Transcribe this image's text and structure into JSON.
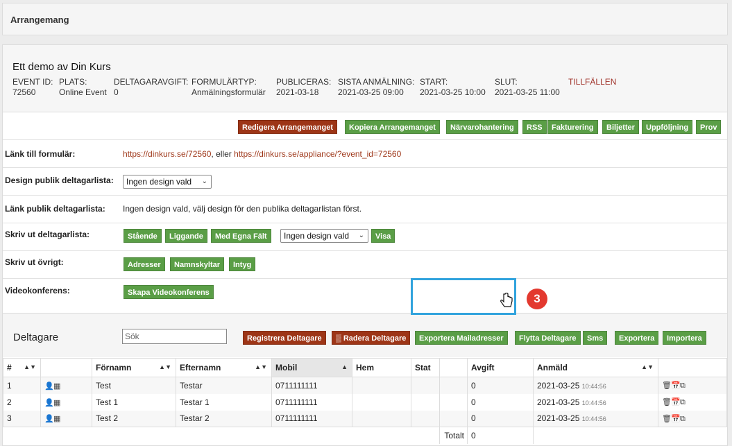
{
  "header": {
    "title": "Arrangemang"
  },
  "event": {
    "title": "Ett demo av Din Kurs",
    "fields": [
      {
        "label": "EVENT ID:",
        "value": "72560"
      },
      {
        "label": "PLATS:",
        "value": "Online Event"
      },
      {
        "label": "DELTAGARAVGIFT:",
        "value": "0"
      },
      {
        "label": "FORMULÄRTYP:",
        "value": "Anmälningsformulär"
      },
      {
        "label": "PUBLICERAS:",
        "value": "2021-03-18"
      },
      {
        "label": "SISTA ANMÄLNING:",
        "value": "2021-03-25 09:00"
      },
      {
        "label": "START:",
        "value": "2021-03-25 10:00"
      },
      {
        "label": "SLUT:",
        "value": "2021-03-25 11:00"
      }
    ],
    "tillfallen": "TILLFÄLLEN"
  },
  "actions": [
    "Redigera Arrangemanget",
    "Kopiera Arrangemanget",
    "Närvarohantering",
    "RSS",
    "Fakturering",
    "Biljetter",
    "Uppföljning",
    "Prov"
  ],
  "rows": {
    "form_link": {
      "label": "Länk till formulär:",
      "link1": "https://dinkurs.se/72560",
      "sep": ", eller ",
      "link2": "https://dinkurs.se/appliance/?event_id=72560"
    },
    "design": {
      "label": "Design publik deltagarlista:",
      "select": "Ingen design vald"
    },
    "public_link": {
      "label": "Länk publik deltagarlista:",
      "text": "Ingen design vald, välj design för den publika deltagarlistan först."
    },
    "print_list": {
      "label": "Skriv ut deltagarlista:",
      "buttons": [
        "Stående",
        "Liggande",
        "Med Egna Fält"
      ],
      "select": "Ingen design vald",
      "show": "Visa"
    },
    "print_other": {
      "label": "Skriv ut övrigt:",
      "buttons": [
        "Adresser",
        "Namnskyltar",
        "Intyg"
      ]
    },
    "video": {
      "label": "Videokonferens:",
      "button": "Skapa Videokonferens"
    }
  },
  "participants": {
    "title": "Deltagare",
    "search_placeholder": "Sök",
    "buttons": [
      "Registrera Deltagare",
      "Radera Deltagare",
      "Exportera Mailadresser",
      "Flytta Deltagare",
      "Sms",
      "Exportera",
      "Importera"
    ],
    "badge": "3",
    "columns": [
      "#",
      "",
      "Förnamn",
      "Efternamn",
      "Mobil",
      "Hem",
      "Stat",
      "",
      "Avgift",
      "Anmäld",
      ""
    ],
    "rows": [
      {
        "n": "1",
        "first": "Test",
        "last": "Testar",
        "mobile": "0711111111",
        "fee": "0",
        "date": "2021-03-25",
        "time": "10:44:56"
      },
      {
        "n": "2",
        "first": "Test 1",
        "last": "Testar 1",
        "mobile": "0711111111",
        "fee": "0",
        "date": "2021-03-25",
        "time": "10:44:56"
      },
      {
        "n": "3",
        "first": "Test 2",
        "last": "Testar 2",
        "mobile": "0711111111",
        "fee": "0",
        "date": "2021-03-25",
        "time": "10:44:56"
      }
    ],
    "total_label": "Totalt",
    "total_value": "0"
  }
}
